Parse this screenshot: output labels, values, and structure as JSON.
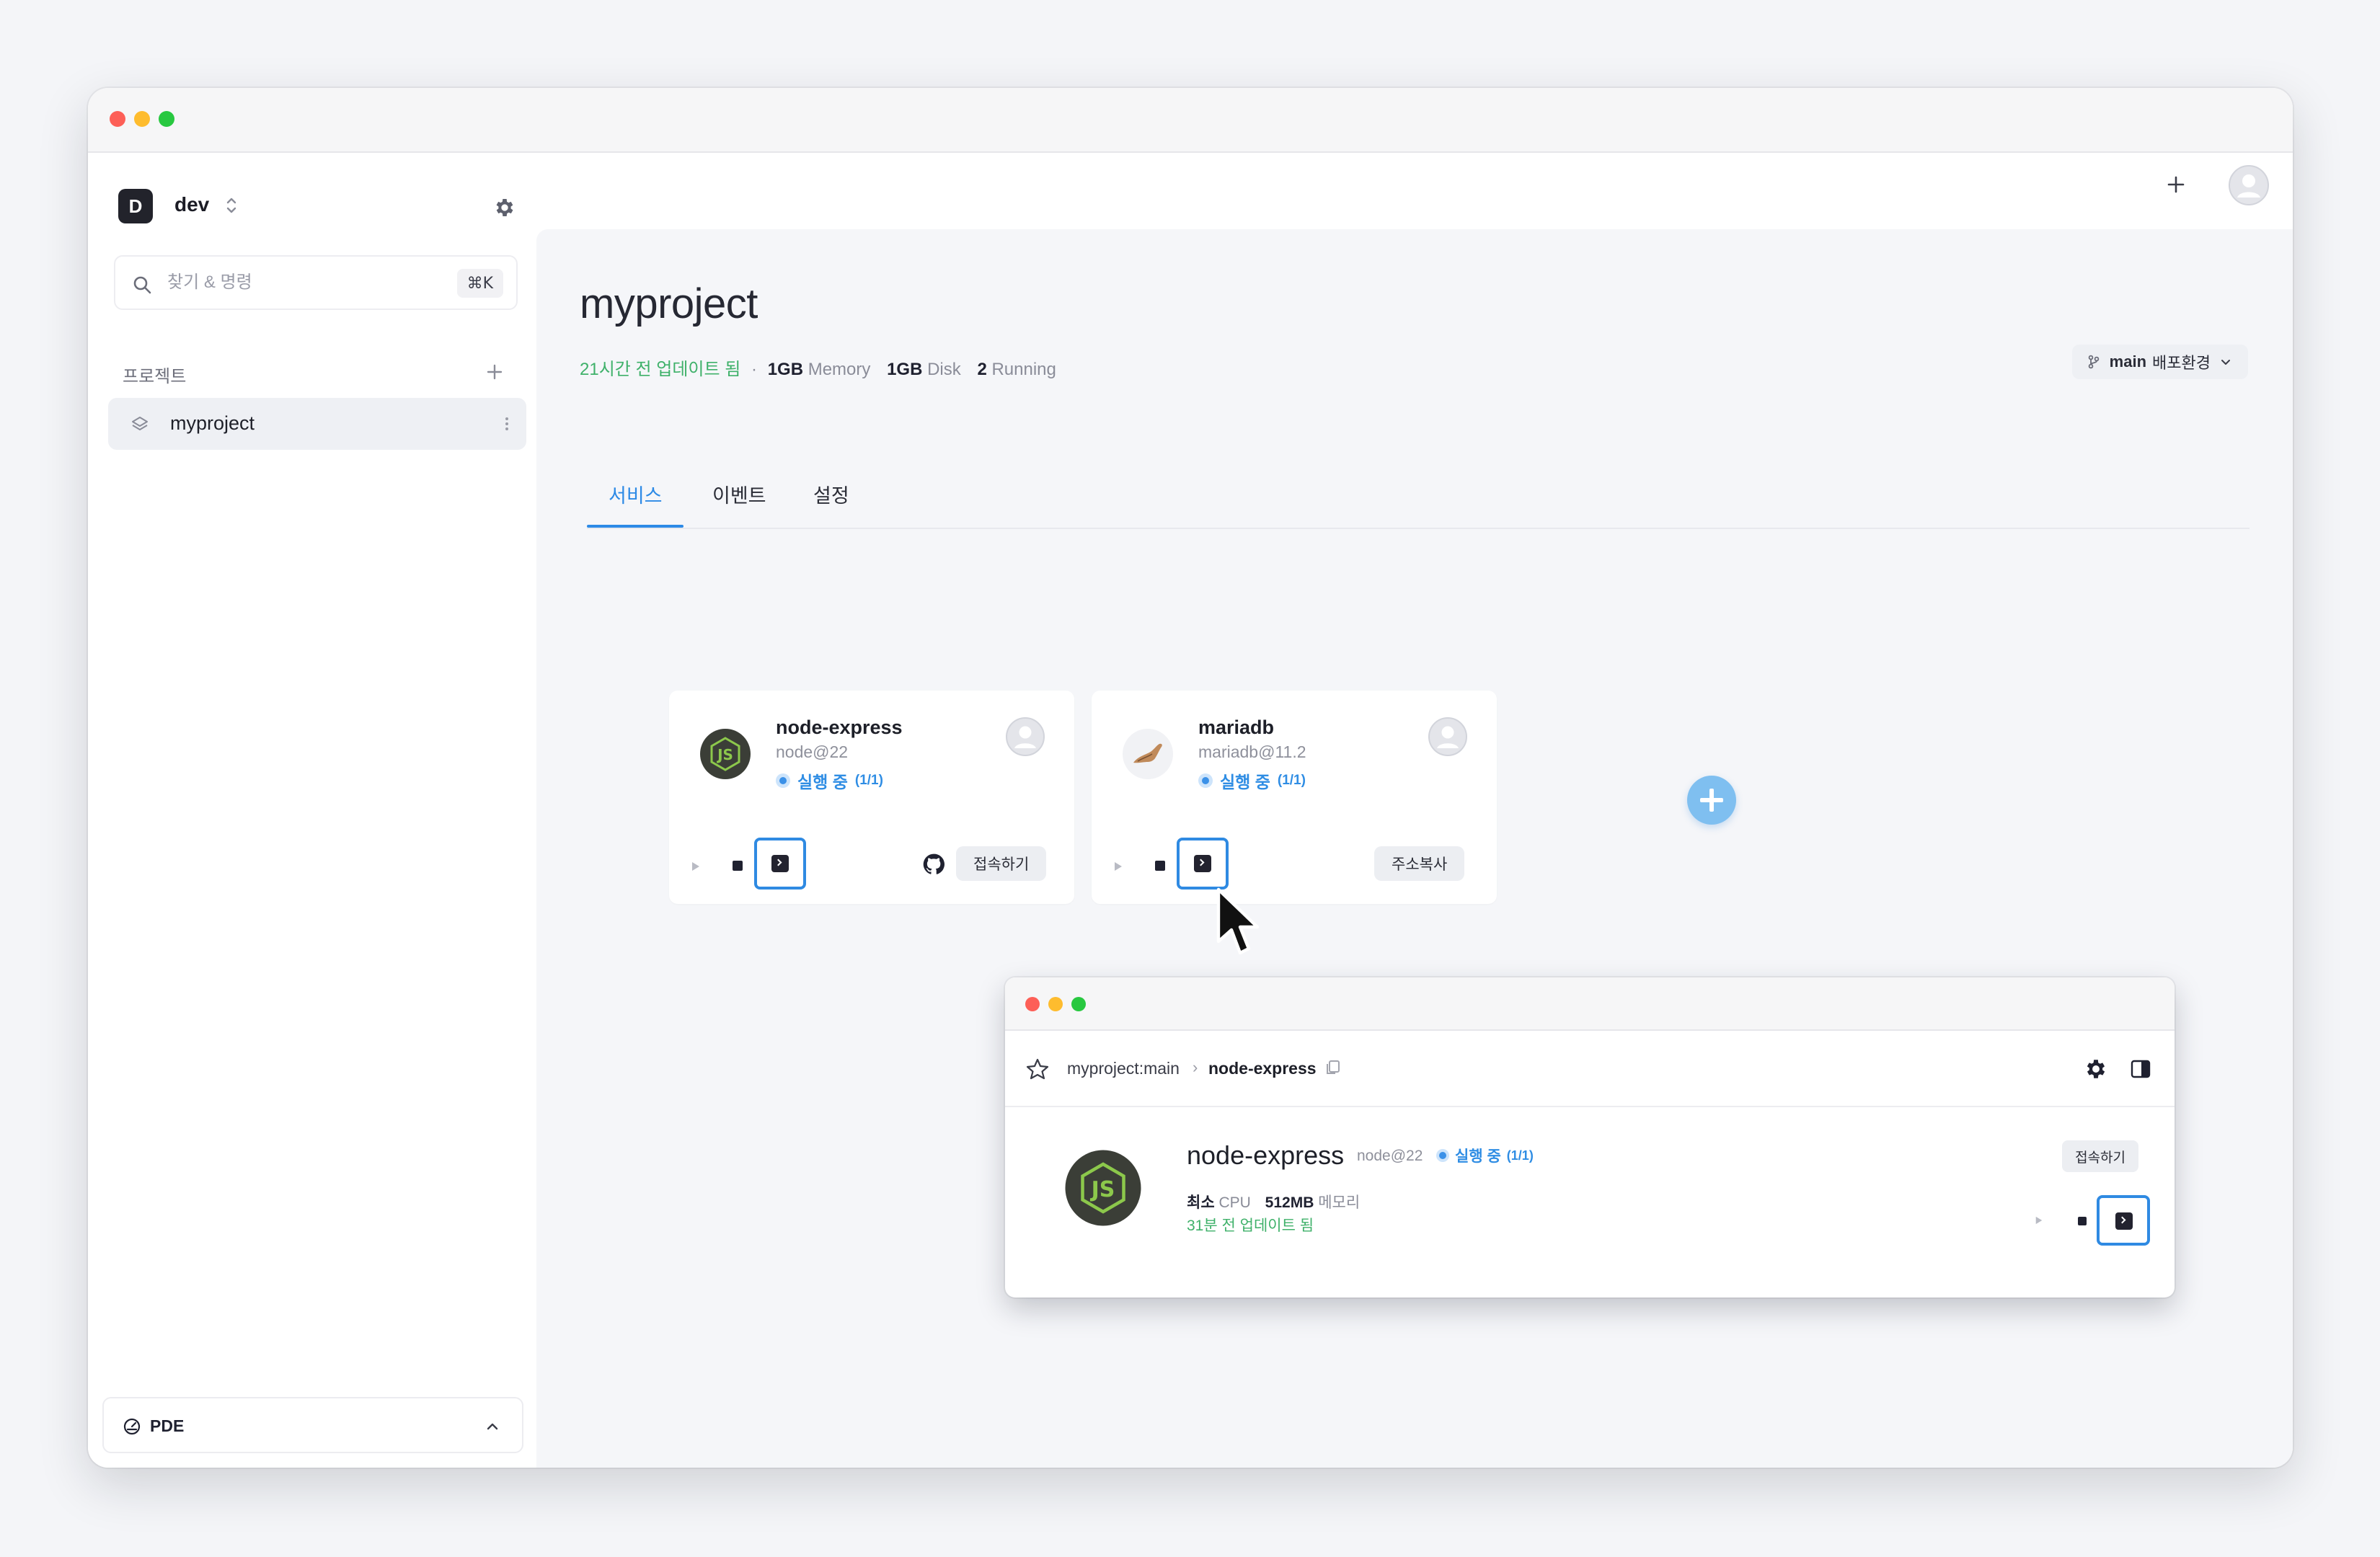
{
  "window": {
    "traffic_lights": {
      "close": "#fd5f57",
      "minimize": "#febc2e",
      "zoom": "#28c840"
    }
  },
  "sidebar": {
    "workspace": {
      "initial": "D",
      "name": "dev"
    },
    "search": {
      "placeholder": "찾기 & 명령",
      "shortcut": "⌘K"
    },
    "section_label": "프로젝트",
    "projects": [
      {
        "label": "myproject",
        "selected": true
      }
    ],
    "footer": {
      "label": "PDE"
    }
  },
  "project": {
    "title": "myproject",
    "updated": "21시간 전 업데이트 됨",
    "separator": "·",
    "memory_value": "1GB",
    "memory_label": "Memory",
    "disk_value": "1GB",
    "disk_label": "Disk",
    "running_value": "2",
    "running_label": "Running",
    "env_branch": "main",
    "env_label": "배포환경"
  },
  "tabs": [
    {
      "label": "서비스",
      "active": true
    },
    {
      "label": "이벤트",
      "active": false
    },
    {
      "label": "설정",
      "active": false
    }
  ],
  "services": [
    {
      "name": "node-express",
      "image": "node@22",
      "status": "실행 중",
      "replicas": "(1/1)",
      "action_label": "접속하기",
      "logo": "nodejs-icon",
      "has_github": true
    },
    {
      "name": "mariadb",
      "image": "mariadb@11.2",
      "status": "실행 중",
      "replicas": "(1/1)",
      "action_label": "주소복사",
      "logo": "mariadb-seal-icon",
      "has_github": false
    }
  ],
  "preview": {
    "breadcrumb_project": "myproject:main",
    "breadcrumb_separator": "›",
    "breadcrumb_service": "node-express",
    "service_name": "node-express",
    "service_image": "node@22",
    "status": "실행 중",
    "replicas": "(1/1)",
    "cpu_value": "최소",
    "cpu_label": "CPU",
    "memory_value": "512MB",
    "memory_label": "메모리",
    "updated": "31분 전 업데이트 됨",
    "action_label": "접속하기"
  },
  "colors": {
    "accent": "#2d8ae6",
    "running": "#2f8de4",
    "updated_green": "#3fb16a",
    "fab": "#7fbff0",
    "node_green": "#8cc84b"
  }
}
